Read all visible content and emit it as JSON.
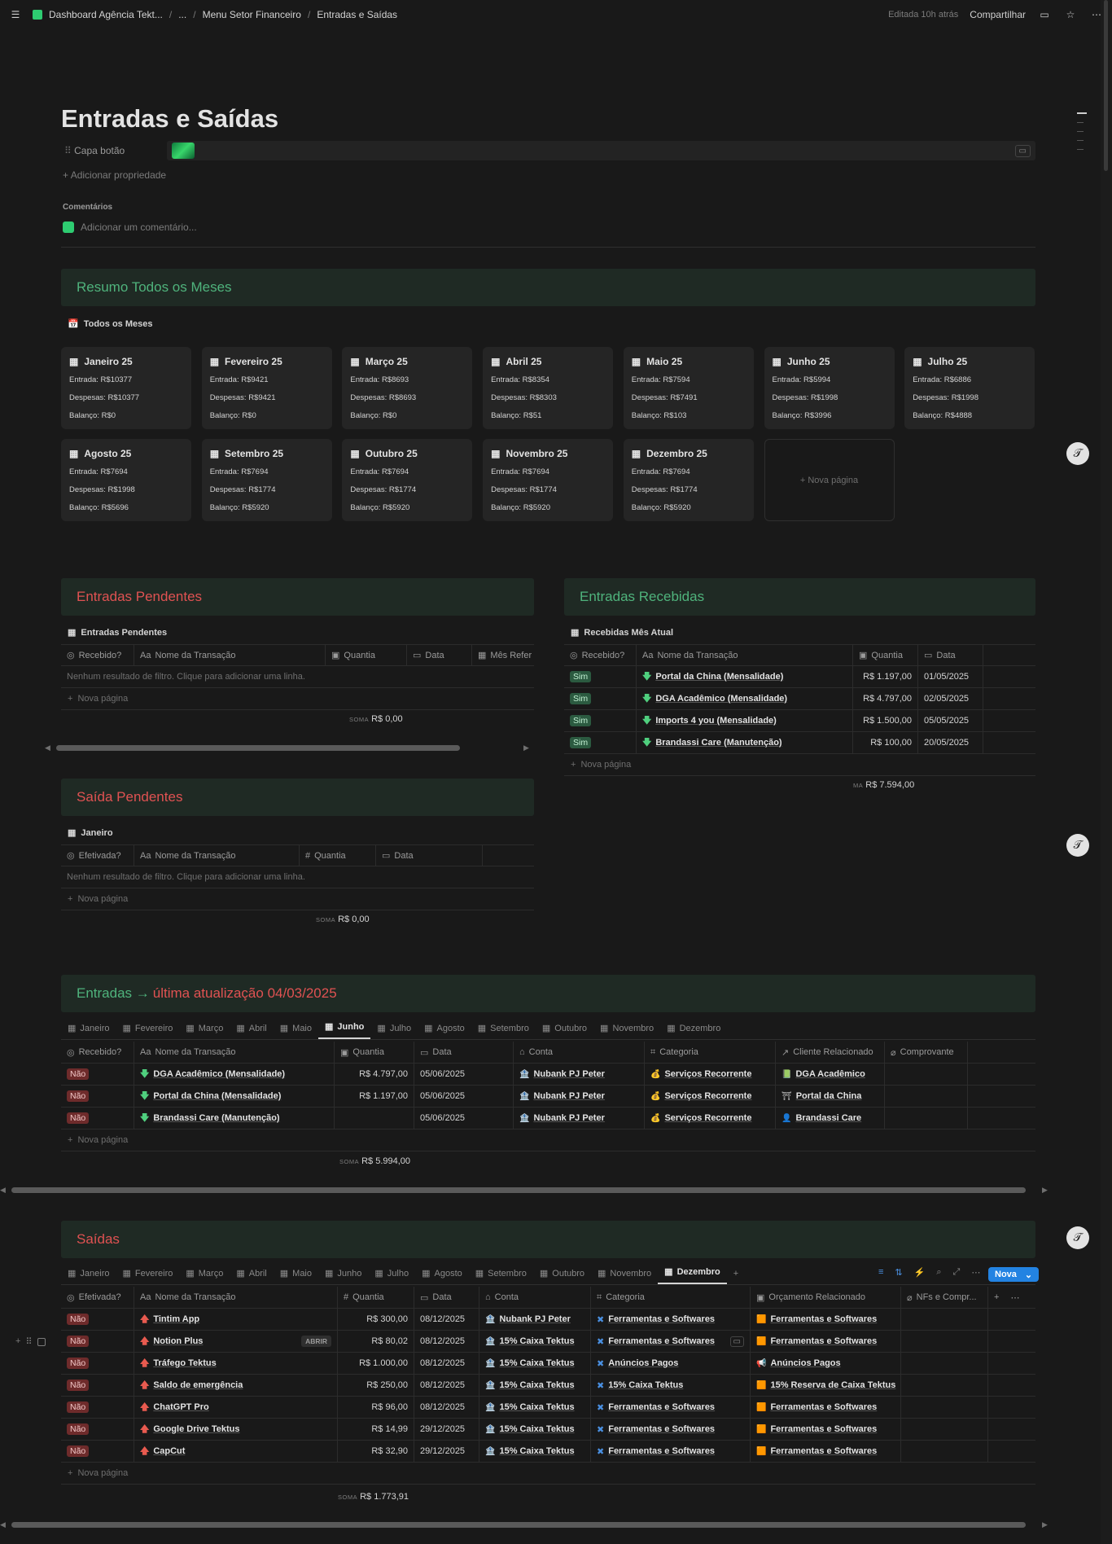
{
  "breadcrumb": {
    "workspace": "Dashboard Agência Tekt...",
    "ellipsis": "...",
    "parent": "Menu Setor Financeiro",
    "current": "Entradas e Saídas"
  },
  "topbar": {
    "edited": "Editada 10h atrás",
    "share": "Compartilhar"
  },
  "page_title": "Entradas e Saídas",
  "property": {
    "name": "Capa botão"
  },
  "add_property": "Adicionar propriedade",
  "comments": {
    "heading": "Comentários",
    "placeholder": "Adicionar um comentário..."
  },
  "resumo": {
    "title": "Resumo Todos os Meses",
    "view": "Todos os Meses",
    "cards": [
      {
        "title": "Janeiro 25",
        "entrada": "Entrada: R$10377",
        "despesas": "Despesas: R$10377",
        "balanco": "Balanço: R$0"
      },
      {
        "title": "Fevereiro 25",
        "entrada": "Entrada: R$9421",
        "despesas": "Despesas: R$9421",
        "balanco": "Balanço: R$0"
      },
      {
        "title": "Março 25",
        "entrada": "Entrada: R$8693",
        "despesas": "Despesas: R$8693",
        "balanco": "Balanço: R$0"
      },
      {
        "title": "Abril 25",
        "entrada": "Entrada: R$8354",
        "despesas": "Despesas: R$8303",
        "balanco": "Balanço: R$51"
      },
      {
        "title": "Maio 25",
        "entrada": "Entrada: R$7594",
        "despesas": "Despesas: R$7491",
        "balanco": "Balanço: R$103"
      },
      {
        "title": "Junho 25",
        "entrada": "Entrada: R$5994",
        "despesas": "Despesas: R$1998",
        "balanco": "Balanço: R$3996"
      },
      {
        "title": "Julho 25",
        "entrada": "Entrada: R$6886",
        "despesas": "Despesas: R$1998",
        "balanco": "Balanço: R$4888"
      },
      {
        "title": "Agosto 25",
        "entrada": "Entrada: R$7694",
        "despesas": "Despesas: R$1998",
        "balanco": "Balanço: R$5696"
      },
      {
        "title": "Setembro 25",
        "entrada": "Entrada: R$7694",
        "despesas": "Despesas: R$1774",
        "balanco": "Balanço: R$5920"
      },
      {
        "title": "Outubro 25",
        "entrada": "Entrada: R$7694",
        "despesas": "Despesas: R$1774",
        "balanco": "Balanço: R$5920"
      },
      {
        "title": "Novembro 25",
        "entrada": "Entrada: R$7694",
        "despesas": "Despesas: R$1774",
        "balanco": "Balanço: R$5920"
      },
      {
        "title": "Dezembro 25",
        "entrada": "Entrada: R$7694",
        "despesas": "Despesas: R$1774",
        "balanco": "Balanço: R$5920"
      }
    ],
    "new_page": "Nova página"
  },
  "entradas_pendentes": {
    "title": "Entradas Pendentes",
    "view": "Entradas Pendentes",
    "cols": [
      "Recebido?",
      "Nome da Transação",
      "Quantia",
      "Data",
      "Mês Refer"
    ],
    "empty": "Nenhum resultado de filtro. Clique para adicionar uma linha.",
    "new_page": "Nova página",
    "sum_label": "SOMA",
    "sum": "R$ 0,00"
  },
  "entradas_recebidas": {
    "title": "Entradas Recebidas",
    "view": "Recebidas Mês Atual",
    "cols": [
      "Recebido?",
      "Nome da Transação",
      "Quantia",
      "Data"
    ],
    "rows": [
      {
        "status": "Sim",
        "name": "Portal da China (Mensalidade)",
        "amount": "R$ 1.197,00",
        "date": "01/05/2025"
      },
      {
        "status": "Sim",
        "name": "DGA Acadêmico (Mensalidade)",
        "amount": "R$ 4.797,00",
        "date": "02/05/2025"
      },
      {
        "status": "Sim",
        "name": "Imports 4 you (Mensalidade)",
        "amount": "R$ 1.500,00",
        "date": "05/05/2025"
      },
      {
        "status": "Sim",
        "name": "Brandassi Care (Manutenção)",
        "amount": "R$ 100,00",
        "date": "20/05/2025"
      }
    ],
    "new_page": "Nova página",
    "sum_label": "MA",
    "sum": "R$ 7.594,00"
  },
  "saida_pendentes": {
    "title": "Saída Pendentes",
    "view": "Janeiro",
    "cols": [
      "Efetivada?",
      "Nome da Transação",
      "Quantia",
      "Data"
    ],
    "empty": "Nenhum resultado de filtro. Clique para adicionar uma linha.",
    "new_page": "Nova página",
    "sum_label": "SOMA",
    "sum": "R$ 0,00"
  },
  "entradas": {
    "title_a": "Entradas → ",
    "title_b": "última atualização 04/03/2025",
    "tabs": [
      "Janeiro",
      "Fevereiro",
      "Março",
      "Abril",
      "Maio",
      "Junho",
      "Julho",
      "Agosto",
      "Setembro",
      "Outubro",
      "Novembro",
      "Dezembro"
    ],
    "active_tab": "Junho",
    "cols": [
      "Recebido?",
      "Nome da Transação",
      "Quantia",
      "Data",
      "Conta",
      "Categoria",
      "Cliente Relacionado",
      "Comprovante"
    ],
    "rows": [
      {
        "status": "Não",
        "name": "DGA Acadêmico (Mensalidade)",
        "amount": "R$ 4.797,00",
        "date": "05/06/2025",
        "conta": "Nubank PJ Peter",
        "cat": "Serviços Recorrente",
        "client": "DGA Acadêmico",
        "client_icon": "📗"
      },
      {
        "status": "Não",
        "name": "Portal da China (Mensalidade)",
        "amount": "R$ 1.197,00",
        "date": "05/06/2025",
        "conta": "Nubank PJ Peter",
        "cat": "Serviços Recorrente",
        "client": "Portal da China",
        "client_icon": "⛩"
      },
      {
        "status": "Não",
        "name": "Brandassi Care (Manutenção)",
        "amount": "",
        "date": "05/06/2025",
        "conta": "Nubank PJ Peter",
        "cat": "Serviços Recorrente",
        "client": "Brandassi Care",
        "client_icon": "👤"
      }
    ],
    "new_page": "Nova página",
    "sum_label": "SOMA",
    "sum": "R$ 5.994,00"
  },
  "saidas": {
    "title": "Saídas",
    "tabs": [
      "Janeiro",
      "Fevereiro",
      "Março",
      "Abril",
      "Maio",
      "Junho",
      "Julho",
      "Agosto",
      "Setembro",
      "Outubro",
      "Novembro",
      "Dezembro"
    ],
    "active_tab": "Dezembro",
    "nova": "Nova",
    "cols": [
      "Efetivada?",
      "Nome da Transação",
      "Quantia",
      "Data",
      "Conta",
      "Categoria",
      "Orçamento Relacionado",
      "NFs e Compr..."
    ],
    "rows": [
      {
        "status": "Não",
        "name": "Tintim App",
        "amount": "R$ 300,00",
        "date": "08/12/2025",
        "conta": "Nubank PJ Peter",
        "cat": "Ferramentas e Softwares",
        "orc": "Ferramentas e Softwares",
        "orc_icon": "🟧"
      },
      {
        "status": "Não",
        "name": "Notion Plus",
        "amount": "R$ 80,02",
        "date": "08/12/2025",
        "conta": "15% Caixa Tektus",
        "cat": "Ferramentas e Softwares",
        "orc": "Ferramentas e Softwares",
        "orc_icon": "🟧",
        "open": "ABRIR"
      },
      {
        "status": "Não",
        "name": "Tráfego Tektus",
        "amount": "R$ 1.000,00",
        "date": "08/12/2025",
        "conta": "15% Caixa Tektus",
        "cat": "Anúncios Pagos",
        "orc": "Anúncios Pagos",
        "orc_icon": "📢"
      },
      {
        "status": "Não",
        "name": "Saldo de emergência",
        "amount": "R$ 250,00",
        "date": "08/12/2025",
        "conta": "15% Caixa Tektus",
        "cat": "15% Caixa Tektus",
        "orc": "15% Reserva de Caixa Tektus",
        "orc_icon": "🟧"
      },
      {
        "status": "Não",
        "name": "ChatGPT Pro",
        "amount": "R$ 96,00",
        "date": "08/12/2025",
        "conta": "15% Caixa Tektus",
        "cat": "Ferramentas e Softwares",
        "orc": "Ferramentas e Softwares",
        "orc_icon": "🟧"
      },
      {
        "status": "Não",
        "name": "Google Drive Tektus",
        "amount": "R$ 14,99",
        "date": "29/12/2025",
        "conta": "15% Caixa Tektus",
        "cat": "Ferramentas e Softwares",
        "orc": "Ferramentas e Softwares",
        "orc_icon": "🟧"
      },
      {
        "status": "Não",
        "name": "CapCut",
        "amount": "R$ 32,90",
        "date": "29/12/2025",
        "conta": "15% Caixa Tektus",
        "cat": "Ferramentas e Softwares",
        "orc": "Ferramentas e Softwares",
        "orc_icon": "🟧"
      }
    ],
    "new_page": "Nova página",
    "sum_label": "SOMA",
    "sum": "R$ 1.773,91"
  }
}
